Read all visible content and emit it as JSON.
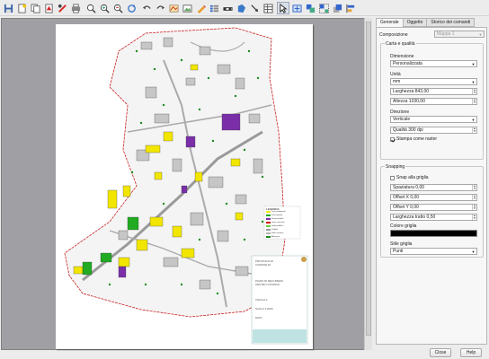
{
  "toolbar": {
    "icons": [
      "save-icon",
      "new-composer-icon",
      "duplicate-icon",
      "pdf-export-icon",
      "svg-export-icon",
      "print-icon",
      "zoom-full-icon",
      "zoom-in-icon",
      "zoom-out-icon",
      "refresh-icon",
      "undo-icon",
      "redo-icon",
      "add-map-icon",
      "add-image-icon",
      "add-label-icon",
      "add-legend-icon",
      "add-scalebar-icon",
      "add-shape-icon",
      "add-arrow-icon",
      "add-table-icon",
      "select-icon",
      "move-content-icon",
      "group-icon",
      "ungroup-icon",
      "raise-icon",
      "align-icon"
    ],
    "active_icon": "select-icon"
  },
  "map_sheet": {
    "legend_title": "LEGENDA",
    "legend_items": [
      {
        "label": "Zona residenziale",
        "color": "#f2e600"
      },
      {
        "label": "Zona agricola",
        "color": "#22aa22"
      },
      {
        "label": "Servizi pubblici",
        "color": "#7a2fa8"
      },
      {
        "label": "Limite comunale",
        "color": "#d00000"
      },
      {
        "label": "Verde pubblico",
        "color": "#6fcf3a"
      },
      {
        "label": "Viabilità",
        "color": "#9a9a9a"
      },
      {
        "label": "Edifici esistenti",
        "color": "#b2b2b2"
      },
      {
        "label": "Alberature",
        "color": "#1e8a1e"
      }
    ],
    "header_lines": [
      "PROVINCIA DI",
      "COMUNE DI"
    ],
    "body_lines": [
      "PIANO DI RECUPERO",
      "CENTRO STORICO",
      "TAVOLA 1",
      "SCALA 1:2000",
      "DATA"
    ]
  },
  "panel": {
    "tabs": [
      {
        "label": "Generale",
        "active": true
      },
      {
        "label": "Oggetto",
        "active": false
      },
      {
        "label": "Storico dei comandi",
        "active": false
      }
    ],
    "composizione_label": "Composizione",
    "composizione_value": "Mappa 1",
    "carta_group_title": "Carta e qualità",
    "dimensione_label": "Dimensione",
    "dimensione_value": "Personalizzata",
    "unita_label": "Unità",
    "unita_value": "mm",
    "larghezza_value": "Larghezza 843,00",
    "altezza_value": "Altezza 1030,00",
    "direzione_label": "Direzione",
    "direzione_value": "Verticale",
    "qualita_value": "Qualità 300 dpi",
    "raster_label": "Stampa come raster",
    "raster_checked": true,
    "snapping_group_title": "Snapping",
    "snap_label": "Snap alla griglia",
    "snap_checked": false,
    "spaziatura_value": "Spaziatura 0,00",
    "offset_x_value": "Offset X 0,00",
    "offset_y_value": "Offset Y 0,00",
    "larghezza_tratto_value": "Larghezza tratto 0,50",
    "colore_griglia_label": "Colore griglia",
    "colore_griglia": "#000000",
    "stile_griglia_label": "Stile griglia",
    "stile_griglia_value": "Punti"
  },
  "buttons": {
    "close": "Close",
    "help": "Help"
  }
}
